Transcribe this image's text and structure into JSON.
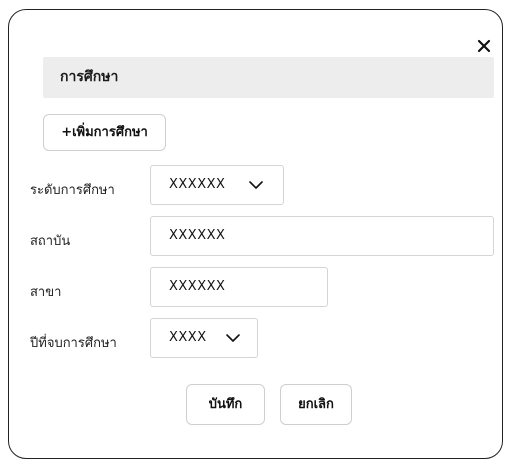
{
  "dialog": {
    "close_icon": "close-icon",
    "section_title": "การศึกษา",
    "add_button_label": "+เพิ่มการศึกษา"
  },
  "form": {
    "education_level": {
      "label": "ระดับการศึกษา",
      "value": "XXXXXX",
      "icon": "chevron-down-icon"
    },
    "institution": {
      "label": "สถาบัน",
      "value": "XXXXXX"
    },
    "major": {
      "label": "สาขา",
      "value": "XXXXXX"
    },
    "graduation_year": {
      "label": "ปีที่จบการศึกษา",
      "value": "XXXX",
      "icon": "chevron-down-icon"
    }
  },
  "actions": {
    "save_label": "บันทึก",
    "cancel_label": "ยกเลิก"
  },
  "colors": {
    "header_bg": "#ededed",
    "border": "#d4d4d4",
    "text": "#111111"
  }
}
